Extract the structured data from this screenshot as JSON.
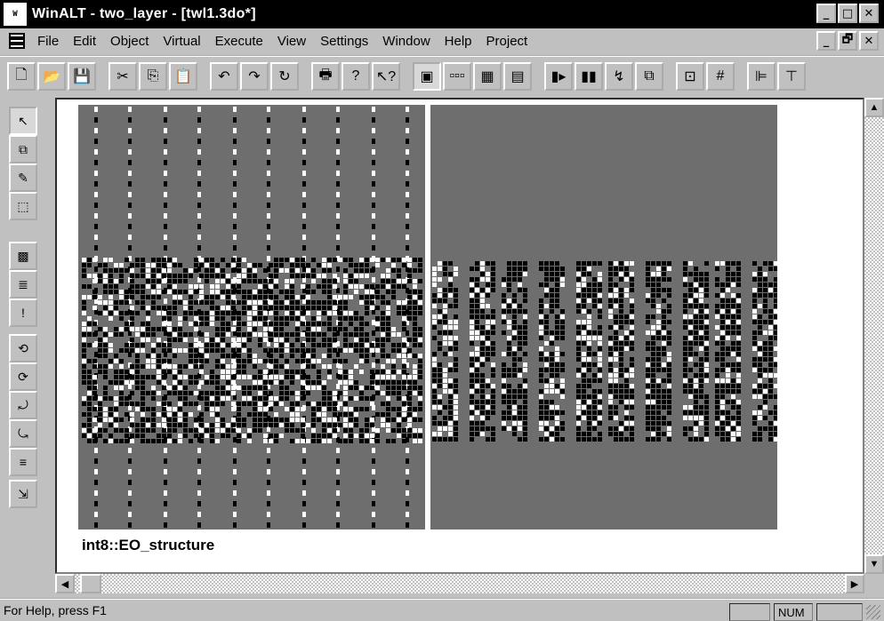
{
  "window": {
    "title": "WinALT - two_layer - [twl1.3do*]",
    "app_icon_text": "W",
    "min": "_",
    "max": "□",
    "close": "✕"
  },
  "menu": {
    "items": [
      "File",
      "Edit",
      "Object",
      "Virtual",
      "Execute",
      "View",
      "Settings",
      "Window",
      "Help",
      "Project"
    ],
    "doc_min": "_",
    "doc_restore": "🗗",
    "doc_close": "✕"
  },
  "toolbar": {
    "buttons": [
      {
        "name": "new-file-icon",
        "glyph": "🗋"
      },
      {
        "name": "open-folder-icon",
        "glyph": "📂"
      },
      {
        "name": "save-disk-icon",
        "glyph": "💾"
      },
      {
        "name": "cut-icon",
        "glyph": "✂"
      },
      {
        "name": "copy-icon",
        "glyph": "⎘"
      },
      {
        "name": "paste-icon",
        "glyph": "📋"
      },
      {
        "name": "undo-icon",
        "glyph": "↶"
      },
      {
        "name": "redo-icon",
        "glyph": "↷"
      },
      {
        "name": "refresh-icon",
        "glyph": "↻"
      },
      {
        "name": "print-icon",
        "glyph": "🖶"
      },
      {
        "name": "help-icon",
        "glyph": "?"
      },
      {
        "name": "context-help-icon",
        "glyph": "↖?"
      },
      {
        "name": "3d-view-icon",
        "glyph": "▣"
      },
      {
        "name": "row-view-icon",
        "glyph": "▫▫▫"
      },
      {
        "name": "grid-view-icon",
        "glyph": "▦"
      },
      {
        "name": "tile-view-icon",
        "glyph": "▤"
      },
      {
        "name": "step-forward-icon",
        "glyph": "▮▸"
      },
      {
        "name": "step-end-icon",
        "glyph": "▮▮"
      },
      {
        "name": "pipe-icon",
        "glyph": "↯"
      },
      {
        "name": "objects-icon",
        "glyph": "⧉"
      },
      {
        "name": "layer-icon",
        "glyph": "⊡"
      },
      {
        "name": "grid-hash-icon",
        "glyph": "#"
      },
      {
        "name": "align-icon",
        "glyph": "⊫"
      },
      {
        "name": "distribute-icon",
        "glyph": "⊤"
      }
    ]
  },
  "palette": {
    "buttons": [
      {
        "name": "pointer-tool-icon",
        "glyph": "↖"
      },
      {
        "name": "copy-tool-icon",
        "glyph": "⧉"
      },
      {
        "name": "pen-tool-icon",
        "glyph": "✎"
      },
      {
        "name": "select-rect-icon",
        "glyph": "⬚"
      },
      {
        "name": "pattern-tool-icon",
        "glyph": "▩"
      },
      {
        "name": "list-tool-icon",
        "glyph": "≣"
      },
      {
        "name": "alert-tool-icon",
        "glyph": "!"
      },
      {
        "name": "func-tool-1-icon",
        "glyph": "⟲"
      },
      {
        "name": "func-tool-2-icon",
        "glyph": "⟳"
      },
      {
        "name": "func-tool-3-icon",
        "glyph": "⤾"
      },
      {
        "name": "func-tool-4-icon",
        "glyph": "⤿"
      },
      {
        "name": "list-tool-2-icon",
        "glyph": "≡"
      },
      {
        "name": "exit-tool-icon",
        "glyph": "⇲"
      }
    ]
  },
  "object_label": "int8::EO_structure",
  "status": {
    "help_text": "For Help, press F1",
    "num": "NUM"
  },
  "colors": {
    "canvas_bg": "#6e6e6e",
    "cell_black": "#000000",
    "cell_white": "#ffffff"
  }
}
